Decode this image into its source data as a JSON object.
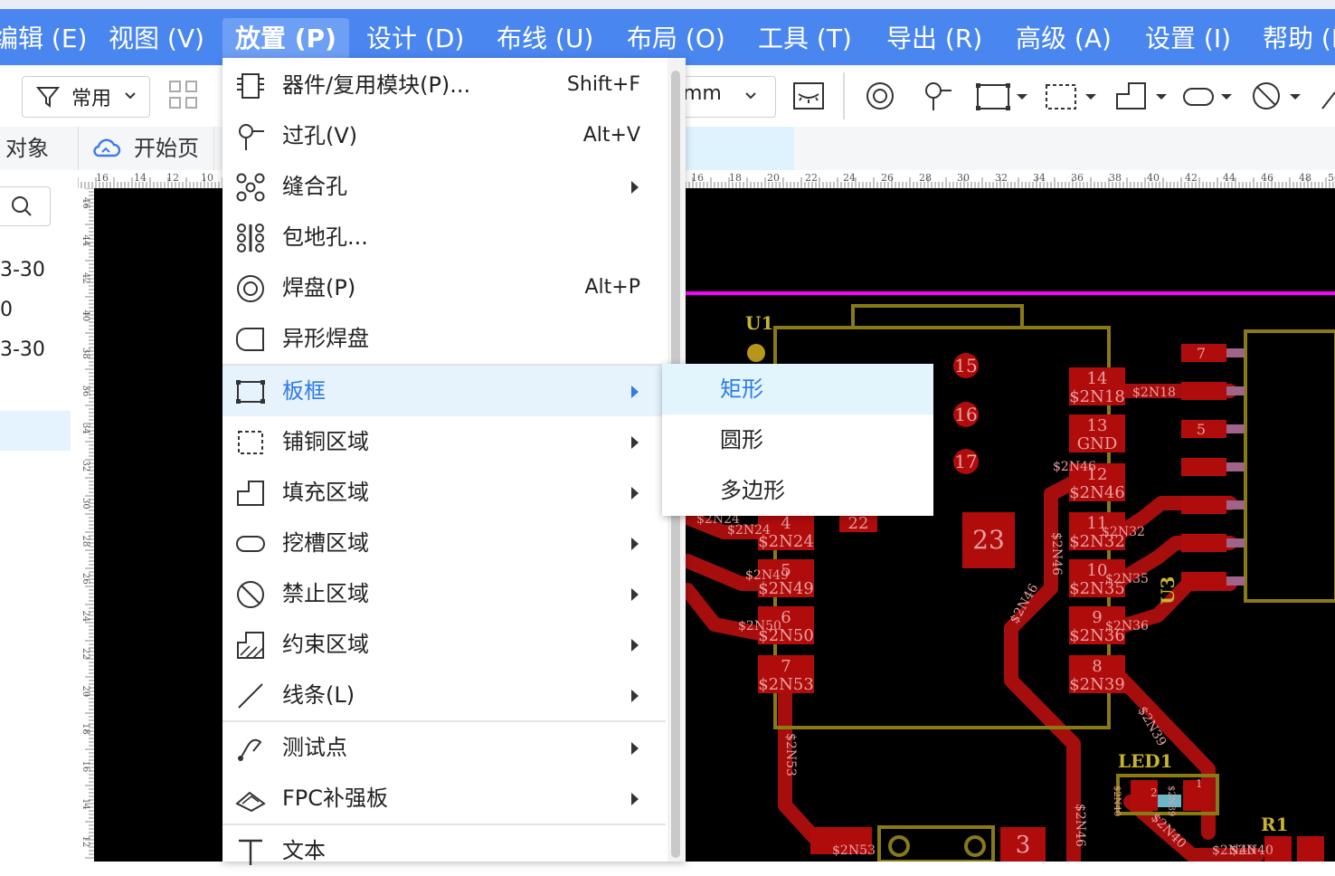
{
  "menubar": {
    "items": [
      "编辑 (E)",
      "视图 (V)",
      "放置 (P)",
      "设计 (D)",
      "布线 (U)",
      "布局 (O)",
      "工具 (T)",
      "导出 (R)",
      "高级 (A)",
      "设置 (I)",
      "帮助 (H)"
    ],
    "active_index": 2
  },
  "toolbar": {
    "filter_label": "常用",
    "unit_value": "mm"
  },
  "tabs": {
    "objects_label": "对象",
    "home_label": "开始页"
  },
  "left_panel": {
    "rows": [
      "3-30",
      "0",
      "3-30"
    ]
  },
  "ruler": {
    "h_ticks": [
      "16",
      "14",
      "12",
      "10",
      "16",
      "18",
      "20",
      "22",
      "24",
      "26",
      "28",
      "30",
      "32",
      "34",
      "36",
      "38",
      "40",
      "42",
      "44",
      "46",
      "48",
      "50"
    ],
    "v_ticks": [
      "46",
      "44",
      "42",
      "40",
      "38",
      "36",
      "34",
      "32",
      "30",
      "28",
      "26",
      "24",
      "22",
      "20",
      "18",
      "16",
      "14",
      "12"
    ]
  },
  "place_menu": {
    "items": [
      {
        "label": "器件/复用模块(P)...",
        "shortcut": "Shift+F",
        "submenu": false,
        "icon": "component-icon"
      },
      {
        "label": "过孔(V)",
        "shortcut": "Alt+V",
        "submenu": false,
        "icon": "via-icon"
      },
      {
        "label": "缝合孔",
        "shortcut": "",
        "submenu": true,
        "icon": "stitch-via-icon"
      },
      {
        "label": "包地孔...",
        "shortcut": "",
        "submenu": false,
        "icon": "ground-via-icon"
      },
      {
        "label": "焊盘(P)",
        "shortcut": "Alt+P",
        "submenu": false,
        "icon": "pad-icon"
      },
      {
        "label": "异形焊盘",
        "shortcut": "",
        "submenu": false,
        "icon": "custom-pad-icon"
      },
      {
        "label": "板框",
        "shortcut": "",
        "submenu": true,
        "icon": "board-outline-icon"
      },
      {
        "label": "铺铜区域",
        "shortcut": "",
        "submenu": true,
        "icon": "copper-pour-icon"
      },
      {
        "label": "填充区域",
        "shortcut": "",
        "submenu": true,
        "icon": "fill-region-icon"
      },
      {
        "label": "挖槽区域",
        "shortcut": "",
        "submenu": true,
        "icon": "slot-region-icon"
      },
      {
        "label": "禁止区域",
        "shortcut": "",
        "submenu": true,
        "icon": "keepout-icon"
      },
      {
        "label": "约束区域",
        "shortcut": "",
        "submenu": true,
        "icon": "constraint-region-icon"
      },
      {
        "label": "线条(L)",
        "shortcut": "",
        "submenu": true,
        "icon": "line-icon"
      },
      {
        "label": "测试点",
        "shortcut": "",
        "submenu": true,
        "icon": "test-point-icon"
      },
      {
        "label": "FPC补强板",
        "shortcut": "",
        "submenu": true,
        "icon": "fpc-stiffener-icon"
      },
      {
        "label": "文本",
        "shortcut": "",
        "submenu": false,
        "icon": "text-icon"
      }
    ],
    "highlighted_index": 6
  },
  "board_outline_submenu": {
    "items": [
      "矩形",
      "圆形",
      "多边形"
    ],
    "highlighted_index": 0
  },
  "pcb": {
    "component_labels": [
      "U1",
      "U3",
      "LED1",
      "R1"
    ],
    "pin_numbers_right": [
      "14",
      "13",
      "12",
      "11",
      "10",
      "9",
      "8"
    ],
    "net_names_right": [
      "$2N18",
      "GND",
      "$2N46",
      "$2N32",
      "$2N35",
      "$2N36",
      "$2N39"
    ],
    "pin_numbers_left": [
      "4",
      "5",
      "6",
      "7"
    ],
    "net_names_left": [
      "$2N24",
      "$2N49",
      "$2N50",
      "$2N53"
    ],
    "pad_numbers_misc": [
      "15",
      "16",
      "17",
      "22",
      "23",
      "3"
    ],
    "u3_pins": [
      "7",
      "5"
    ],
    "trace_labels": [
      "$2N18",
      "$2N32",
      "$2N35",
      "$2N36",
      "$2N46",
      "$2N46",
      "$2N46",
      "$2N49",
      "$2N50",
      "$2N24",
      "$2N53",
      "$2N39",
      "$2N40",
      "$2N40",
      "$2N53",
      "$2N46",
      "$2N24"
    ],
    "led_pins": [
      "2",
      "1"
    ],
    "led_nets": [
      "$2N40",
      "$2N39"
    ],
    "r1_net": "$2N40",
    "colors": {
      "background": "#000000",
      "pad": "#b00c0c",
      "silkscreen": "#8a7a16",
      "outline": "#ff00ff",
      "trace": "#a60e0e"
    }
  },
  "colors": {
    "menubar": "#4a86ef",
    "highlight": "#e6f3fd",
    "accent": "#2f7ae5"
  }
}
